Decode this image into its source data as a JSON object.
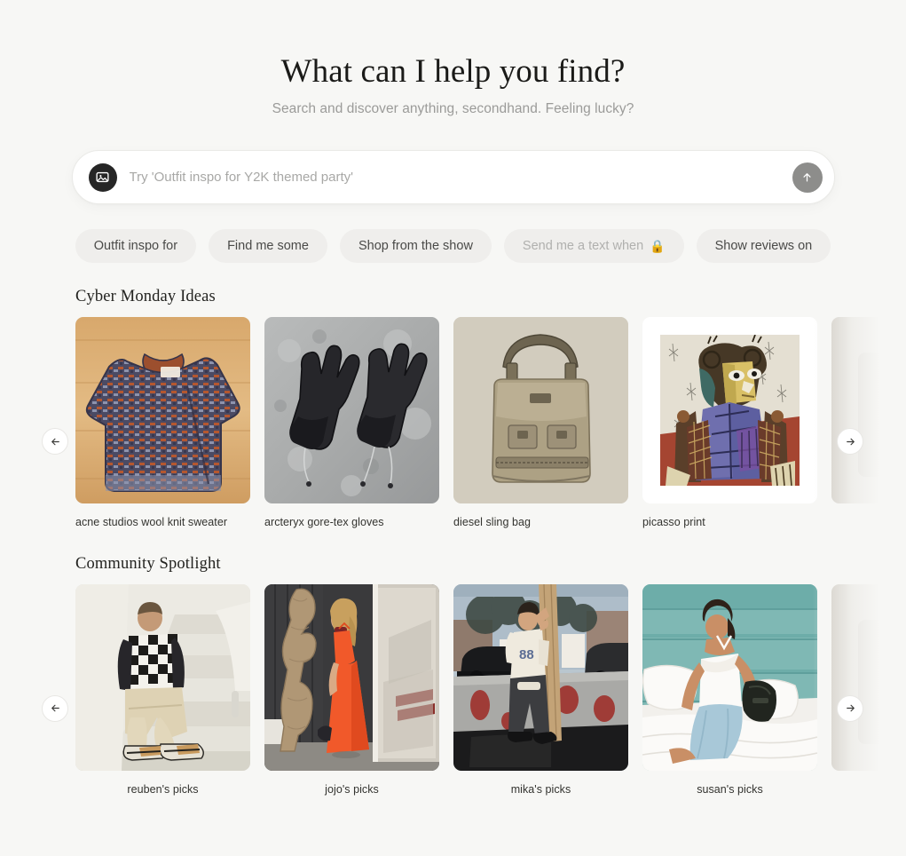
{
  "hero": {
    "title": "What can I help you find?",
    "subtitle": "Search and discover anything, secondhand. Feeling lucky?"
  },
  "search": {
    "placeholder": "Try 'Outfit inspo for Y2K themed party'",
    "value": "",
    "image_button_icon": "image-icon",
    "submit_icon": "arrow-up-icon",
    "submit_bg": "#8d8d8b",
    "image_button_bg": "#262626"
  },
  "chips": [
    {
      "label": "Outfit inspo for",
      "emoji": "",
      "muted": false
    },
    {
      "label": "Find me some",
      "emoji": "",
      "muted": false
    },
    {
      "label": "Shop from the show",
      "emoji": "",
      "muted": false
    },
    {
      "label": "Send me a text when",
      "emoji": "🔒",
      "muted": true
    },
    {
      "label": "Show reviews on",
      "emoji": "",
      "muted": false
    }
  ],
  "sections": [
    {
      "title": "Cyber Monday Ideas",
      "caption_align": "left",
      "prev_icon": "arrow-left-icon",
      "next_icon": "arrow-right-icon",
      "cards": [
        {
          "caption": "acne studios wool knit sweater",
          "art": "sweater"
        },
        {
          "caption": "arcteryx gore-tex gloves",
          "art": "gloves"
        },
        {
          "caption": "diesel sling bag",
          "art": "slingbag"
        },
        {
          "caption": "picasso print",
          "art": "picasso"
        },
        {
          "caption": "",
          "art": "peek1"
        }
      ]
    },
    {
      "title": "Community Spotlight",
      "caption_align": "center",
      "prev_icon": "arrow-left-icon",
      "next_icon": "arrow-right-icon",
      "cards": [
        {
          "caption": "reuben's picks",
          "art": "reuben"
        },
        {
          "caption": "jojo's picks",
          "art": "jojo"
        },
        {
          "caption": "mika's picks",
          "art": "mika"
        },
        {
          "caption": "susan's picks",
          "art": "susan"
        },
        {
          "caption": "",
          "art": "peek2"
        }
      ]
    }
  ],
  "theme": {
    "background": "#f7f7f5",
    "text": "#1a1a18",
    "muted_text": "#9b9b99",
    "chip_bg": "#efeeec"
  }
}
